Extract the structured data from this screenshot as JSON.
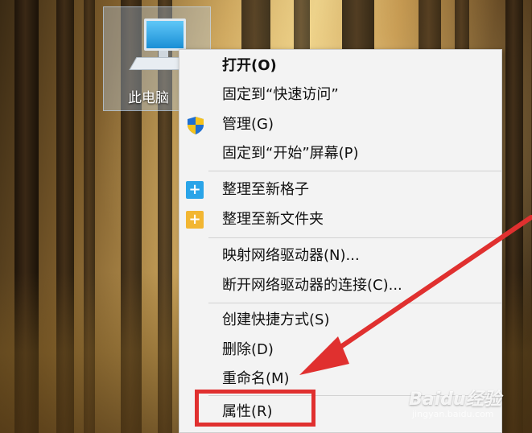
{
  "desktop": {
    "icon_label": "此电脑",
    "icon_name": "this-pc-icon"
  },
  "context_menu": {
    "items": [
      {
        "label": "打开(O)",
        "bold": true
      },
      {
        "label": "固定到“快速访问”"
      },
      {
        "label": "管理(G)",
        "icon": "uac-shield-icon"
      },
      {
        "label": "固定到“开始”屏幕(P)"
      },
      {
        "label": "整理至新格子",
        "icon": "blue-plus-icon"
      },
      {
        "label": "整理至新文件夹",
        "icon": "yellow-plus-icon"
      },
      {
        "label": "映射网络驱动器(N)..."
      },
      {
        "label": "断开网络驱动器的连接(C)..."
      },
      {
        "label": "创建快捷方式(S)"
      },
      {
        "label": "删除(D)"
      },
      {
        "label": "重命名(M)"
      },
      {
        "label": "属性(R)",
        "highlighted": true
      }
    ]
  },
  "annotation": {
    "arrow_color": "#e0302f",
    "highlight_color": "#e0302f",
    "highlighted_item": "属性(R)"
  },
  "watermark": {
    "text": "Baidu经验",
    "sub": "jingyan.baidu.com"
  }
}
